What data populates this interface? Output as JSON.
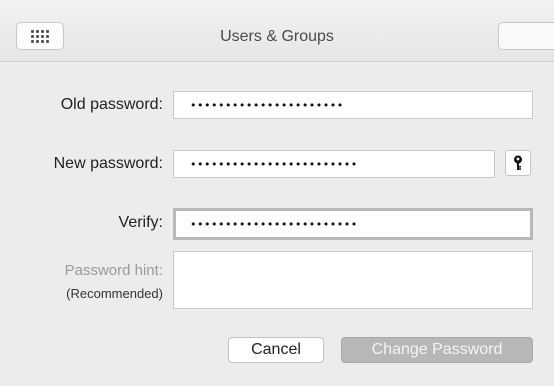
{
  "titlebar": {
    "title": "Users & Groups",
    "grid_button_icon": "grid-dots-icon"
  },
  "form": {
    "old_password": {
      "label": "Old password:",
      "value": "••••••••••••••••••••••"
    },
    "new_password": {
      "label": "New password:",
      "value": "••••••••••••••••••••••••",
      "assistant_icon": "key-icon"
    },
    "verify": {
      "label": "Verify:",
      "value": "••••••••••••••••••••••••"
    },
    "hint": {
      "label": "Password hint:",
      "sublabel": "(Recommended)",
      "value": ""
    }
  },
  "buttons": {
    "cancel": "Cancel",
    "change_password": "Change Password"
  },
  "colors": {
    "background": "#ececec",
    "disabled_button": "#b7b7b7"
  }
}
